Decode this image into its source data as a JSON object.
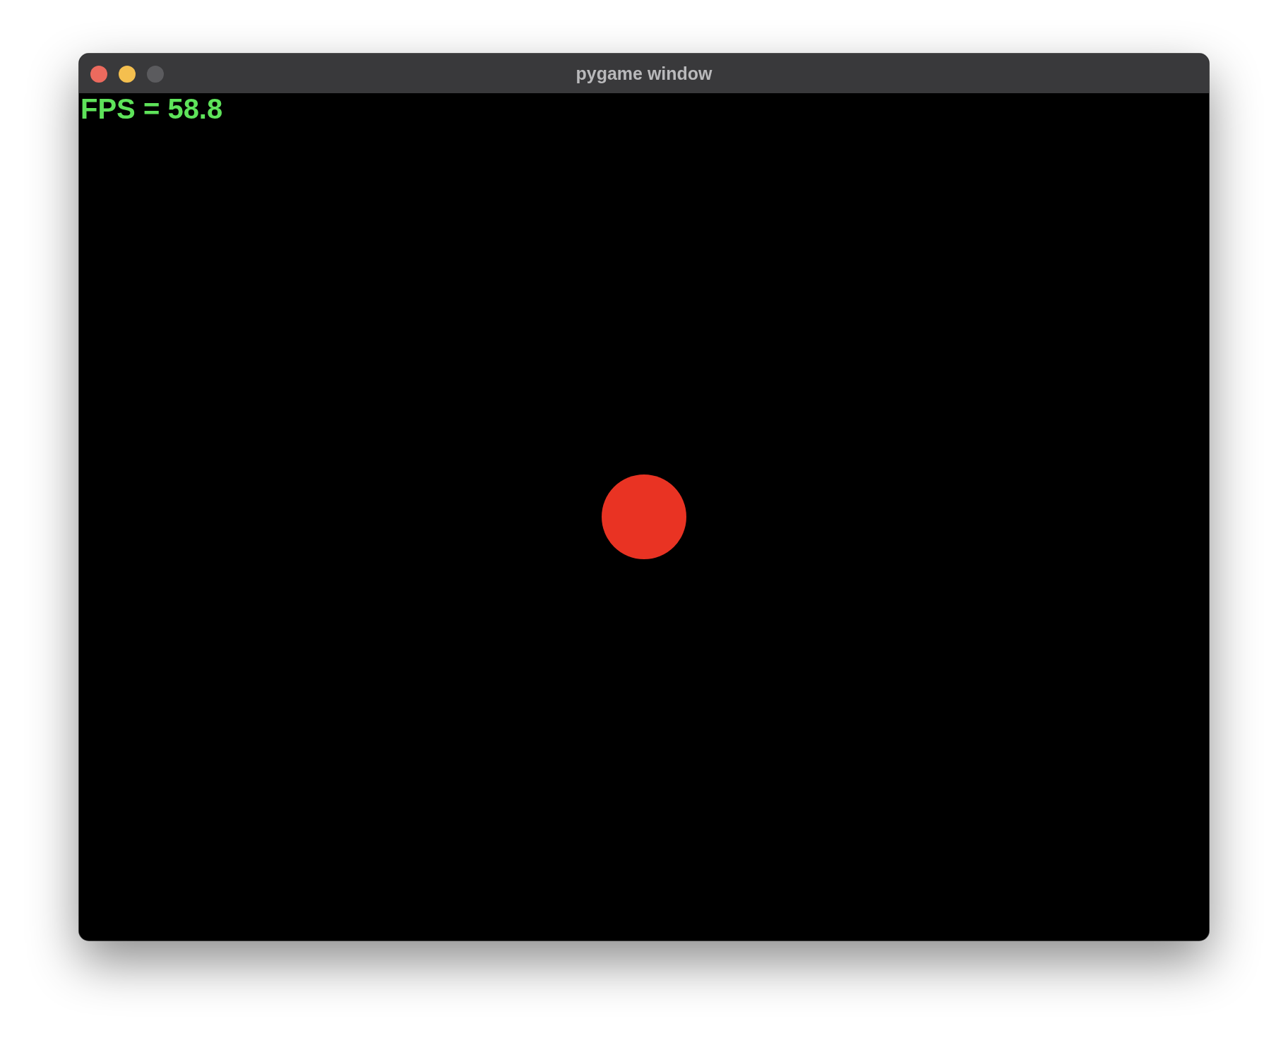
{
  "window": {
    "title": "pygame window"
  },
  "window_controls": [
    {
      "kind": "close",
      "disabled": false
    },
    {
      "kind": "minimize",
      "disabled": false
    },
    {
      "kind": "zoom",
      "disabled": true
    }
  ],
  "canvas": {
    "fps_text": "FPS = 58.8"
  }
}
